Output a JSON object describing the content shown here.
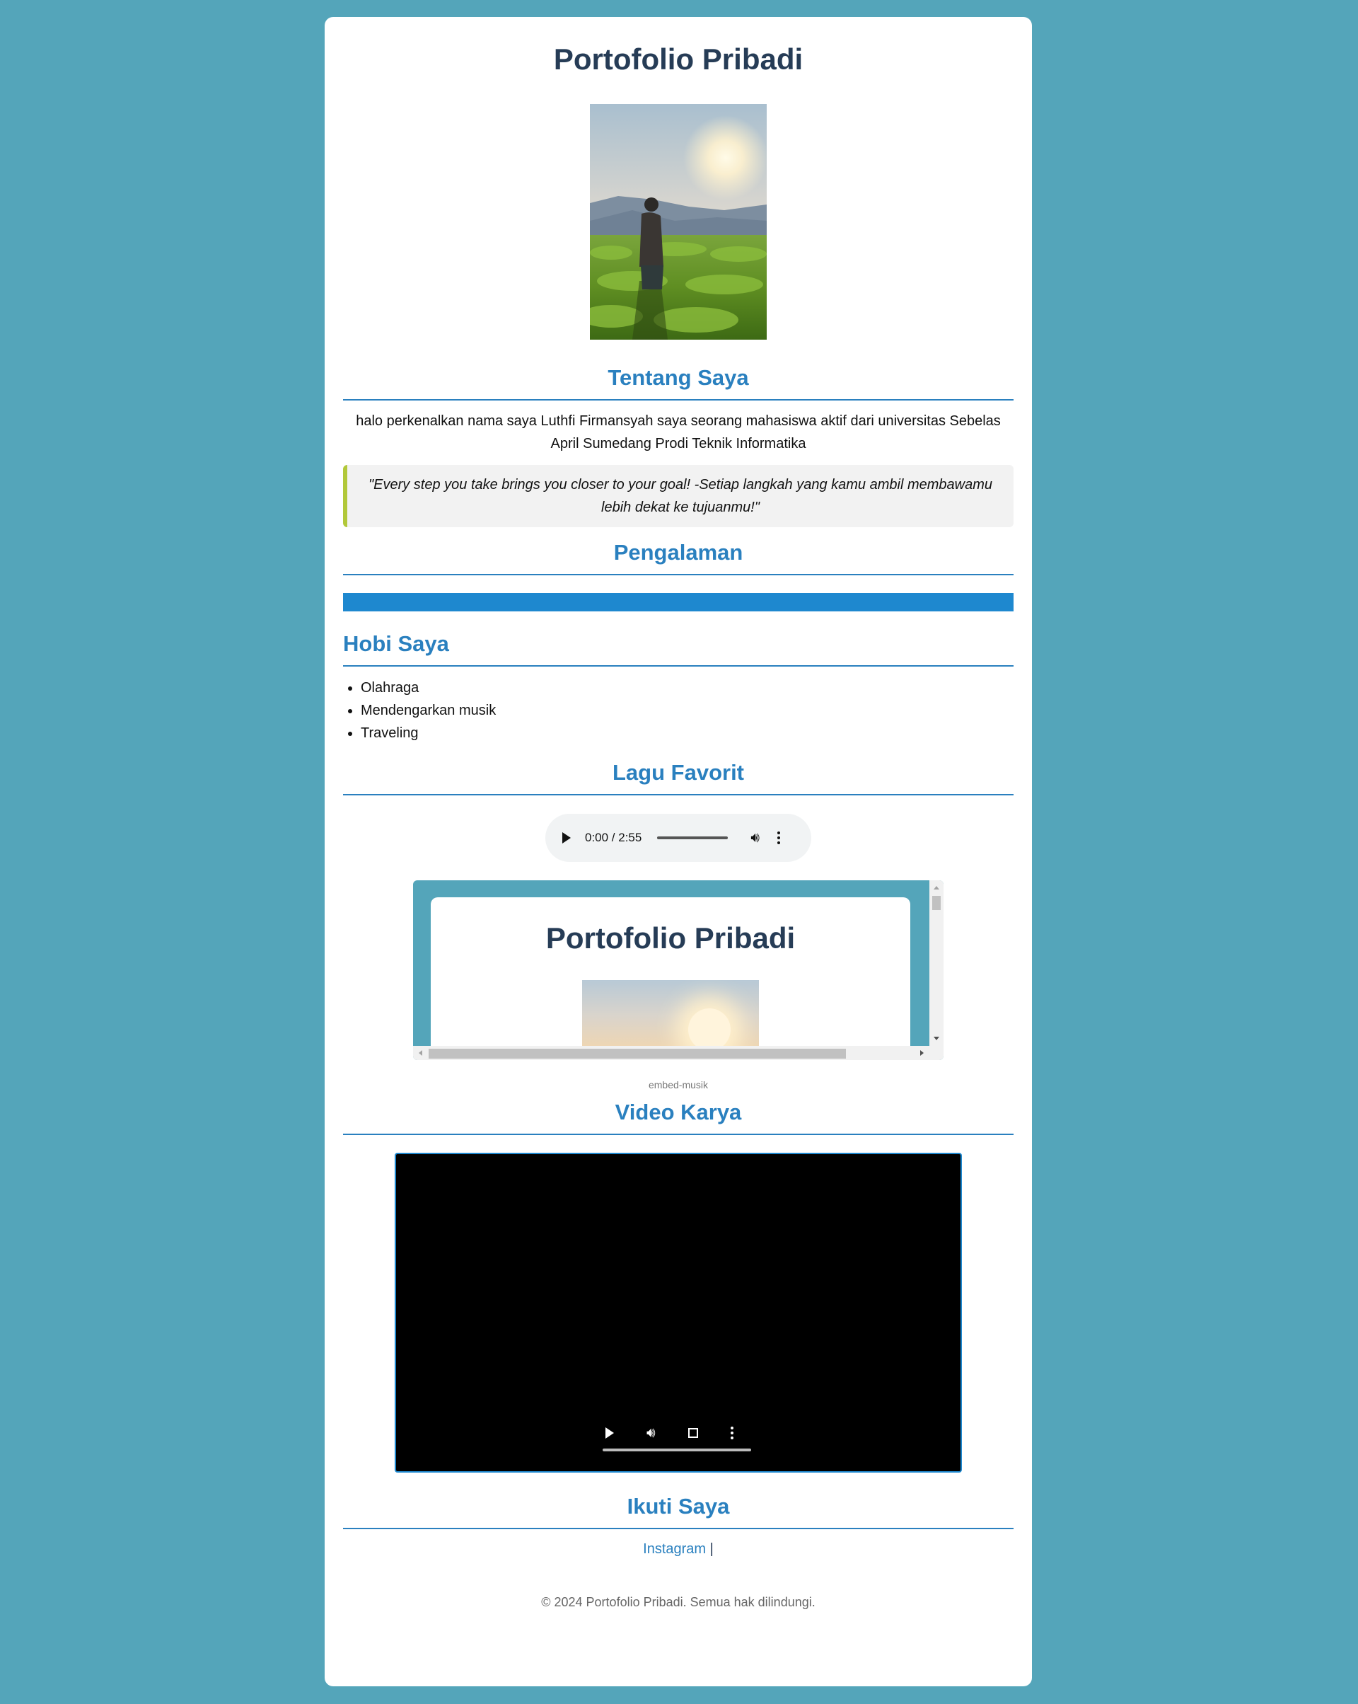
{
  "page": {
    "title": "Portofolio Pribadi"
  },
  "about": {
    "heading": "Tentang Saya",
    "text": "halo perkenalkan nama saya Luthfi Firmansyah saya seorang mahasiswa aktif dari universitas Sebelas April Sumedang Prodi Teknik Informatika",
    "quote": "\"Every step you take brings you closer to your goal! -Setiap langkah yang kamu ambil membawamu lebih dekat ke tujuanmu!\""
  },
  "experience": {
    "heading": "Pengalaman"
  },
  "hobbies": {
    "heading": "Hobi Saya",
    "items": [
      "Olahraga",
      "Mendengarkan musik",
      "Traveling"
    ]
  },
  "music": {
    "heading": "Lagu Favorit",
    "player_time": "0:00 / 2:55",
    "embed_title": "Portofolio Pribadi",
    "caption": "embed-musik"
  },
  "video": {
    "heading": "Video Karya"
  },
  "social": {
    "heading": "Ikuti Saya",
    "instagram": "Instagram",
    "separator": "|"
  },
  "footer": {
    "text": "© 2024 Portofolio Pribadi. Semua hak dilindungi."
  },
  "colors": {
    "background": "#54a5ba",
    "accent": "#2a80bf",
    "title": "#263c56",
    "quote_border": "#b2c83a",
    "bar": "#1e88cf"
  }
}
